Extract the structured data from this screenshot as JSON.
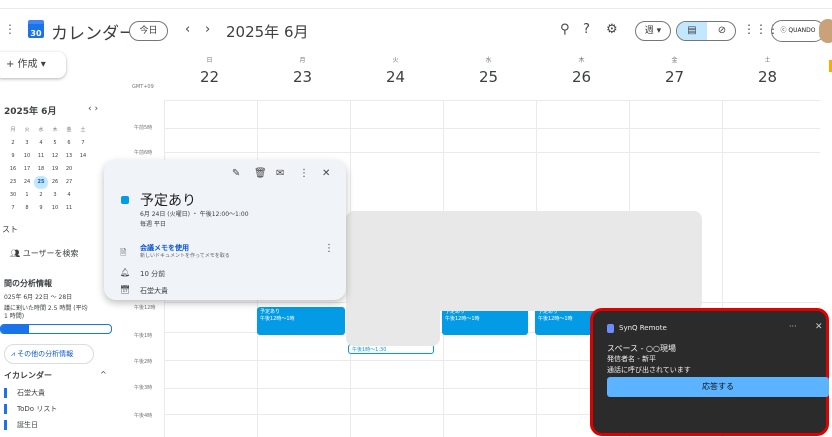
{
  "header": {
    "app_title": "カレンダー",
    "today_label": "今日",
    "month_label": "2025年 6月",
    "view_label": "週 ▾",
    "account_label": "ⓒ QUANDO"
  },
  "sidebar": {
    "create_label": "+ 作成 ▾",
    "mini_cal_title": "2025年 6月",
    "mini_nav": "‹ ›",
    "mini_weekdays": [
      "月",
      "火",
      "水",
      "木",
      "金",
      "土"
    ],
    "mini_rows": [
      [
        "2",
        "3",
        "4",
        "5",
        "6",
        "7"
      ],
      [
        "9",
        "10",
        "11",
        "12",
        "13",
        "14"
      ],
      [
        "16",
        "17",
        "18",
        "19",
        "20",
        ""
      ],
      [
        "23",
        "24",
        "25",
        "26",
        "27",
        ""
      ],
      [
        "30",
        "1",
        "2",
        "3",
        "4",
        ""
      ],
      [
        "7",
        "8",
        "9",
        "10",
        "11",
        ""
      ]
    ],
    "mini_today": "25",
    "section_list": "スト",
    "search_people": "ユーザーを検索",
    "analytics_title": "間の分析情報",
    "analytics_range": "025年 6月 22日 ～ 28日",
    "analytics_detail": "議に割いた時間 2.5 時間 (平均",
    "analytics_detail2": "1 時間)",
    "analytics_progress": 0.25,
    "more_analytics": "その他の分析情報",
    "my_calendars": "イカレンダー",
    "calendars": [
      "石堂大貴",
      "ToDo リスト",
      "誕生日"
    ]
  },
  "grid": {
    "timezone": "GMT+09",
    "days": [
      {
        "dow": "日",
        "num": "22"
      },
      {
        "dow": "月",
        "num": "23"
      },
      {
        "dow": "火",
        "num": "24"
      },
      {
        "dow": "水",
        "num": "25"
      },
      {
        "dow": "木",
        "num": "26"
      },
      {
        "dow": "金",
        "num": "27"
      },
      {
        "dow": "土",
        "num": "28"
      }
    ],
    "hours": [
      "午前5時",
      "午前6時",
      "午後12時",
      "午後1時",
      "午後2時",
      "午後3時",
      "午後4時"
    ],
    "event_title": "予定あり",
    "event_time": "午後12時～1時",
    "event_outline": "午後1時～1:30"
  },
  "popup": {
    "title": "予定あり",
    "date_time": "6月 24日 (火曜日) ・ 午後12:00～1:00",
    "recurrence": "毎週 平日",
    "notes_link": "会議メモを使用",
    "notes_desc": "新しいドキュメントを作ってメモを取る",
    "reminder": "10 分前",
    "calendar_name": "石堂大貴"
  },
  "notification": {
    "app_name": "SynQ Remote",
    "line1": "スペース - ○○現場",
    "line2": "発信者名 - 新平",
    "line3": "通話に呼び出されています",
    "answer_label": "応答する"
  }
}
